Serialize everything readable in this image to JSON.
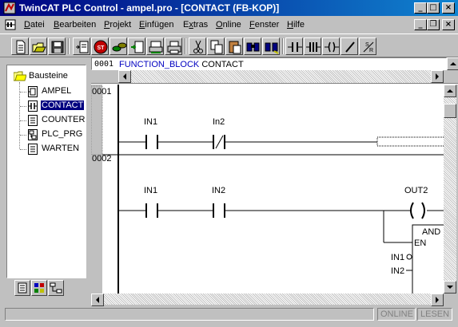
{
  "window": {
    "title": "TwinCAT PLC Control - ampel.pro - [CONTACT (FB-KOP)]",
    "controls": {
      "minimize": "_",
      "maximize": "□",
      "close": "×"
    },
    "mdi_controls": {
      "minimize": "_",
      "restore": "❐",
      "close": "×"
    }
  },
  "menu": {
    "items": [
      {
        "label": "Datei",
        "accel": "D",
        "rest": "atei"
      },
      {
        "label": "Bearbeiten",
        "accel": "B",
        "rest": "earbeiten"
      },
      {
        "label": "Projekt",
        "accel": "P",
        "rest": "rojekt"
      },
      {
        "label": "Einfügen",
        "accel": "E",
        "rest": "infügen"
      },
      {
        "label": "Extras",
        "accel": "x",
        "pre": "E",
        "rest": "tras"
      },
      {
        "label": "Online",
        "accel": "O",
        "rest": "nline"
      },
      {
        "label": "Fenster",
        "accel": "F",
        "rest": "enster"
      },
      {
        "label": "Hilfe",
        "accel": "H",
        "rest": "ilfe"
      }
    ]
  },
  "toolbar": {
    "buttons": [
      "new-icon",
      "open-icon",
      "save-icon",
      "build-icon",
      "stop-icon",
      "login-icon",
      "logout-icon",
      "download-icon",
      "print-icon",
      "cut-icon",
      "copy-icon",
      "paste-icon",
      "find-icon",
      "find-next-icon",
      "contact-icon",
      "parallel-contact-icon",
      "coil-icon",
      "negate-icon",
      "set-reset-icon"
    ],
    "set_reset_label": "S R"
  },
  "tree": {
    "root": "Bausteine",
    "items": [
      {
        "label": "AMPEL",
        "icon": "function-block-icon",
        "selected": false
      },
      {
        "label": "CONTACT",
        "icon": "ladder-block-icon",
        "selected": true
      },
      {
        "label": "COUNTER",
        "icon": "text-block-icon",
        "selected": false
      },
      {
        "label": "PLC_PRG",
        "icon": "flowchart-block-icon",
        "selected": false
      },
      {
        "label": "WARTEN",
        "icon": "text-block-icon",
        "selected": false
      }
    ]
  },
  "panel_tabs": [
    "pous-tab-icon",
    "datatypes-tab-icon",
    "resources-tab-icon"
  ],
  "declaration": {
    "line_number": "0001",
    "keyword": "FUNCTION_BLOCK",
    "name": "CONTACT"
  },
  "ladder": {
    "networks": [
      {
        "number": "0001",
        "contacts": [
          {
            "name": "IN1",
            "negated": false
          },
          {
            "name": "In2",
            "negated": true
          }
        ]
      },
      {
        "number": "0002",
        "contacts": [
          {
            "name": "IN1",
            "negated": false
          },
          {
            "name": "IN2",
            "negated": false
          }
        ],
        "coil": "OUT2",
        "block": {
          "type": "AND",
          "inputs": [
            "EN",
            "IN1",
            "IN2"
          ],
          "negated_input": "IN1"
        }
      }
    ]
  },
  "status": {
    "online": "ONLINE",
    "read": "LESEN"
  }
}
